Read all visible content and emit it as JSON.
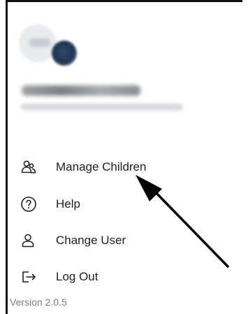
{
  "drawer": {
    "menu": [
      {
        "id": "manage-children",
        "label": "Manage Children",
        "icon": "children-icon"
      },
      {
        "id": "help",
        "label": "Help",
        "icon": "help-circle-icon"
      },
      {
        "id": "change-user",
        "label": "Change User",
        "icon": "user-icon"
      },
      {
        "id": "log-out",
        "label": "Log Out",
        "icon": "logout-icon"
      }
    ],
    "version_text": "Version 2.0.5"
  },
  "annotation": {
    "arrow_color": "#000000"
  }
}
